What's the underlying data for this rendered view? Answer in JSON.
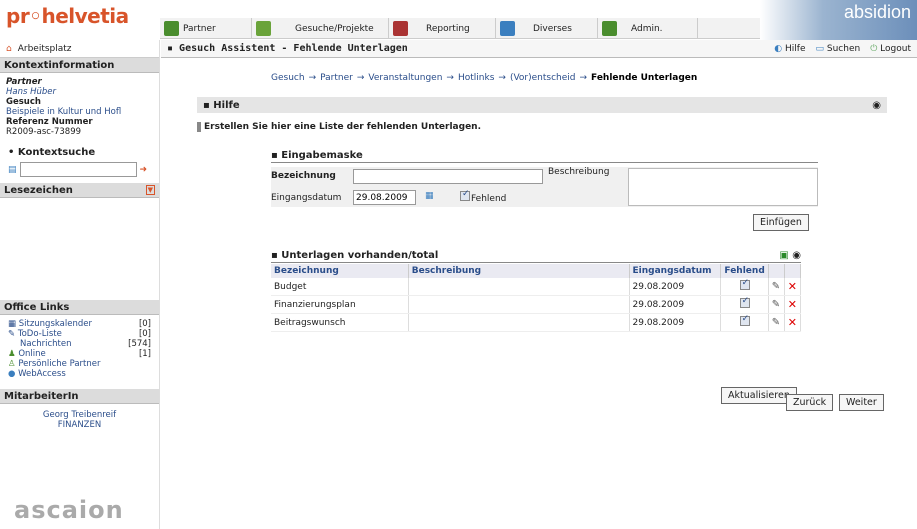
{
  "app": {
    "logo": "pr◦helvetia",
    "brand": "absidion",
    "ascaion": "ascaion"
  },
  "topnav": [
    {
      "label": "Partner",
      "icon": "users-icon",
      "color": "#4a8d2e"
    },
    {
      "label": "Gesuche/Projekte",
      "icon": "recycle-icon",
      "color": "#6aa33a"
    },
    {
      "label": "Reporting",
      "icon": "books-icon",
      "color": "#a33"
    },
    {
      "label": "Diverses",
      "icon": "doc-icon",
      "color": "#3b7fbf"
    },
    {
      "label": "Admin.",
      "icon": "tools-icon",
      "color": "#4a8d2e"
    }
  ],
  "left": {
    "arbeitsplatz": "Arbeitsplatz",
    "kontext_title": "Kontextinformation",
    "kontext": {
      "partner_label": "Partner",
      "partner": "Hans Hüber",
      "gesuch_label": "Gesuch",
      "gesuch": "Beispiele in Kultur und Hofl",
      "ref_label": "Referenz Nummer",
      "ref": "R2009-asc-73899"
    },
    "kontextsuche": "Kontextsuche",
    "lesezeichen": "Lesezeichen",
    "office_title": "Office Links",
    "office": [
      {
        "label": "Sitzungskalender",
        "count": "[0]"
      },
      {
        "label": "ToDo-Liste",
        "count": "[0]"
      },
      {
        "label": "Nachrichten",
        "count": "[574]"
      },
      {
        "label": "Online",
        "count": "[1]"
      },
      {
        "label": "Persönliche Partner",
        "count": ""
      },
      {
        "label": "WebAccess",
        "count": ""
      }
    ],
    "mit_title": "MitarbeiterIn",
    "mit_name": "Georg Treibenreif",
    "mit_dept": "FINANZEN"
  },
  "main": {
    "title": "Gesuch Assistent - Fehlende Unterlagen",
    "hilfe_btn": "Hilfe",
    "suchen_btn": "Suchen",
    "logout_btn": "Logout",
    "crumbs": [
      "Gesuch",
      "Partner",
      "Veranstaltungen",
      "Hotlinks",
      "(Vor)entscheid",
      "Fehlende Unterlagen"
    ],
    "hilfe_title": "Hilfe",
    "help_text": "Erstellen Sie hier eine Liste der fehlenden Unterlagen.",
    "eing_title": "Eingabemaske",
    "bez_label": "Bezeichnung",
    "bez_value": "",
    "beschr_label": "Beschreibung",
    "beschr_value": "",
    "datum_label": "Eingangsdatum",
    "datum_value": "29.08.2009",
    "fehlend_label": "Fehlend",
    "einfuegen": "Einfügen",
    "ut_title": "Unterlagen vorhanden/total",
    "cols": [
      "Bezeichnung",
      "Beschreibung",
      "Eingangsdatum",
      "Fehlend"
    ],
    "rows": [
      {
        "bez": "Budget",
        "beschr": "",
        "datum": "29.08.2009"
      },
      {
        "bez": "Finanzierungsplan",
        "beschr": "",
        "datum": "29.08.2009"
      },
      {
        "bez": "Beitragswunsch",
        "beschr": "",
        "datum": "29.08.2009"
      }
    ],
    "aktualisieren": "Aktualisieren",
    "zurueck": "Zurück",
    "weiter": "Weiter"
  }
}
